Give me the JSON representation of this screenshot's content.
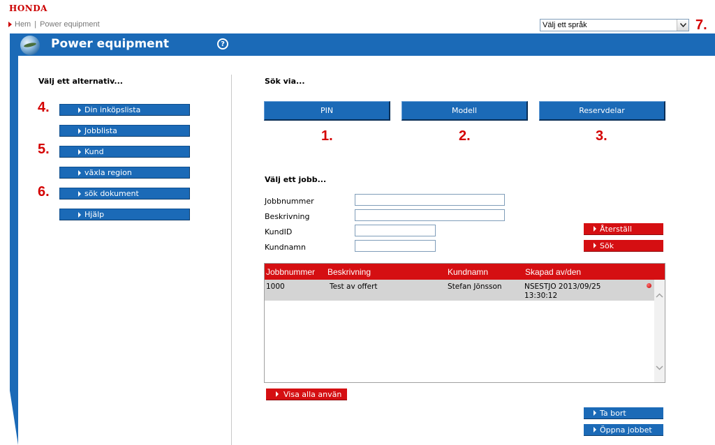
{
  "brand": {
    "logo": "HONDA"
  },
  "breadcrumb": {
    "home": "Hem",
    "separator": "|",
    "current": "Power equipment"
  },
  "language": {
    "selected": "Välj ett språk"
  },
  "header": {
    "title": "Power equipment",
    "help_symbol": "?"
  },
  "left": {
    "title": "Välj ett alternativ...",
    "menu": [
      {
        "label": "Din inköpslista"
      },
      {
        "label": "Jobblista"
      },
      {
        "label": "Kund"
      },
      {
        "label": "växla region"
      },
      {
        "label": "sök dokument"
      },
      {
        "label": "Hjälp"
      }
    ]
  },
  "search": {
    "title": "Sök via...",
    "buttons": [
      {
        "label": "PIN"
      },
      {
        "label": "Modell"
      },
      {
        "label": "Reservdelar"
      }
    ]
  },
  "markers": {
    "m1": "1.",
    "m2": "2.",
    "m3": "3.",
    "m4": "4.",
    "m5": "5.",
    "m6": "6.",
    "m7": "7."
  },
  "jobs": {
    "title": "Välj ett jobb...",
    "fields": {
      "jobbnummer": {
        "label": "Jobbnummer",
        "value": ""
      },
      "beskrivning": {
        "label": "Beskrivning",
        "value": ""
      },
      "kundid": {
        "label": "KundID",
        "value": ""
      },
      "kundnamn": {
        "label": "Kundnamn",
        "value": ""
      }
    },
    "reset_label": "Återställ",
    "search_label": "Sök",
    "table": {
      "headers": [
        "Jobbnummer",
        "Beskrivning",
        "Kundnamn",
        "Skapad av/den"
      ],
      "rows": [
        {
          "jobbnummer": "1000",
          "beskrivning": "Test av offert",
          "kundnamn": "Stefan Jönsson",
          "skapad_line1": "NSESTJO 2013/09/25",
          "skapad_line2": "13:30:12"
        }
      ]
    },
    "show_all_label": "Visa alla använ",
    "delete_label": "Ta bort",
    "open_label": "Öppna jobbet"
  },
  "colors": {
    "brand_blue": "#1b6ab7",
    "brand_red": "#d50f12",
    "marker_red": "#d40000"
  }
}
